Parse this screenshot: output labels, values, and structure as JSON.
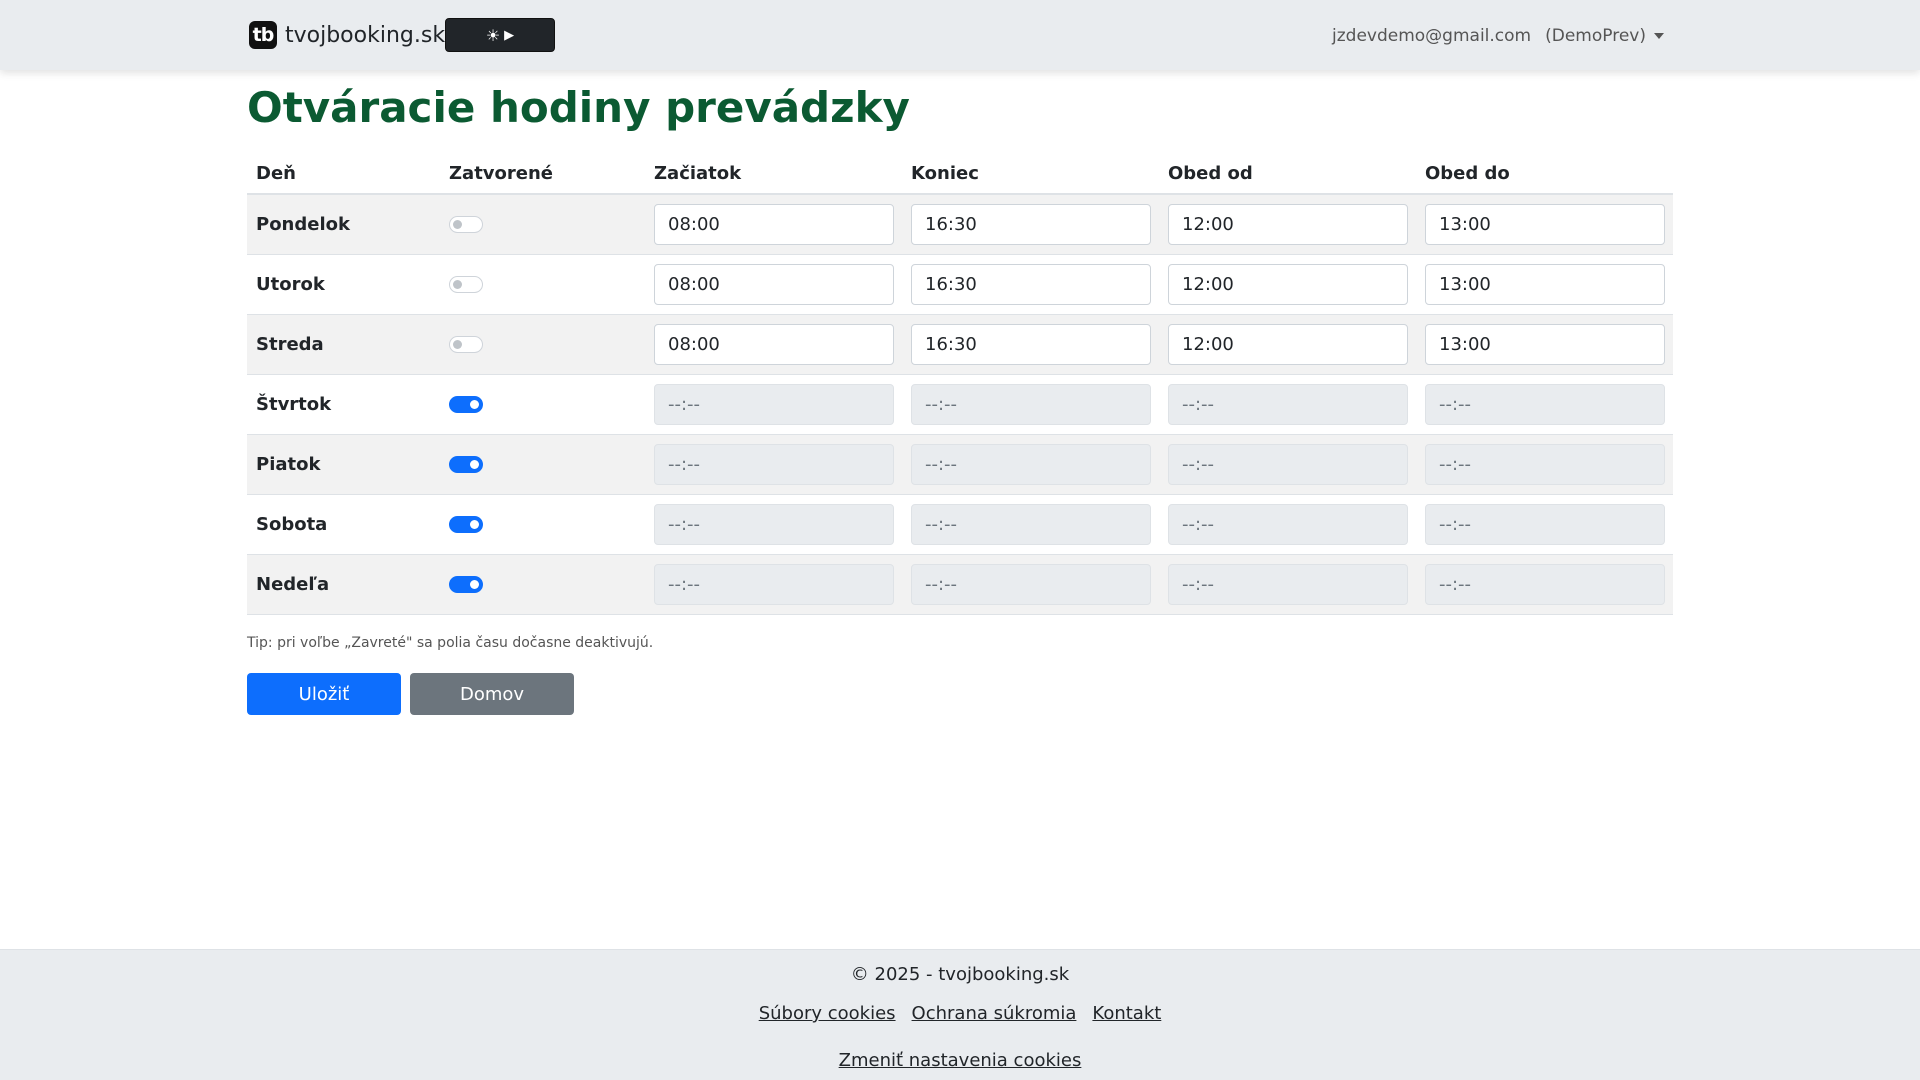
{
  "nav": {
    "brand_logo": "tb",
    "brand_name": "tvojbooking.sk",
    "theme_sun": "☀",
    "theme_play": "▶",
    "user_email": "jzdevdemo@gmail.com",
    "tenant": "(DemoPrev)"
  },
  "page": {
    "title": "Otváracie hodiny prevádzky"
  },
  "table": {
    "headers": [
      "Deň",
      "Zatvorené",
      "Začiatok",
      "Koniec",
      "Obed od",
      "Obed do"
    ],
    "rows": [
      {
        "day": "Pondelok",
        "closed": false,
        "start": "08:00",
        "end": "16:30",
        "lunch_from": "12:00",
        "lunch_to": "13:00"
      },
      {
        "day": "Utorok",
        "closed": false,
        "start": "08:00",
        "end": "16:30",
        "lunch_from": "12:00",
        "lunch_to": "13:00"
      },
      {
        "day": "Streda",
        "closed": false,
        "start": "08:00",
        "end": "16:30",
        "lunch_from": "12:00",
        "lunch_to": "13:00"
      },
      {
        "day": "Štvrtok",
        "closed": true,
        "start": "--:--",
        "end": "--:--",
        "lunch_from": "--:--",
        "lunch_to": "--:--"
      },
      {
        "day": "Piatok",
        "closed": true,
        "start": "--:--",
        "end": "--:--",
        "lunch_from": "--:--",
        "lunch_to": "--:--"
      },
      {
        "day": "Sobota",
        "closed": true,
        "start": "--:--",
        "end": "--:--",
        "lunch_from": "--:--",
        "lunch_to": "--:--"
      },
      {
        "day": "Nedeľa",
        "closed": true,
        "start": "--:--",
        "end": "--:--",
        "lunch_from": "--:--",
        "lunch_to": "--:--"
      }
    ]
  },
  "tip": "Tip: pri voľbe „Zavreté\" sa polia času dočasne deaktivujú.",
  "buttons": {
    "save": "Uložiť",
    "home": "Domov"
  },
  "footer": {
    "copyright": "© 2025 - tvojbooking.sk",
    "links": [
      "Súbory cookies",
      "Ochrana súkromia",
      "Kontakt"
    ],
    "cookie_settings": "Zmeniť nastavenia cookies"
  },
  "colors": {
    "title": "#0b5a32",
    "primary": "#0d6efd",
    "secondary": "#6c757d",
    "navbar_bg": "#e9ecef"
  }
}
